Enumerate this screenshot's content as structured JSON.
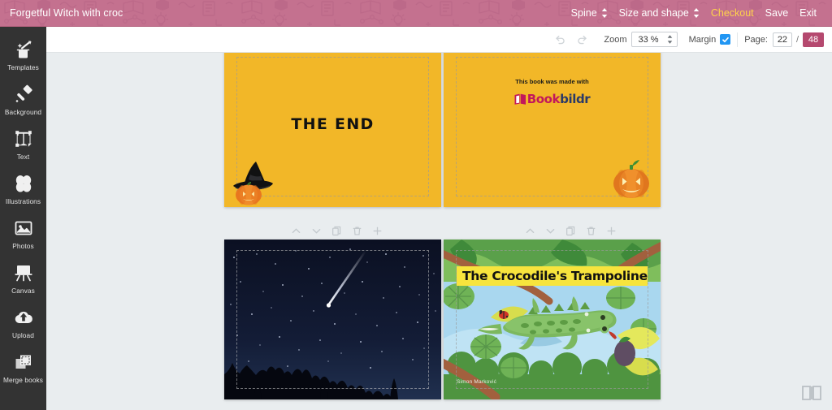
{
  "header": {
    "title": "Forgetful Witch with croc",
    "menu": [
      {
        "label": "Spine",
        "icon": "updown-arrows-icon",
        "name": "spine"
      },
      {
        "label": "Size and shape",
        "icon": "updown-arrows-icon",
        "name": "size-and-shape"
      },
      {
        "label": "Checkout",
        "icon": "",
        "name": "checkout"
      },
      {
        "label": "Save",
        "icon": "",
        "name": "save"
      },
      {
        "label": "Exit",
        "icon": "",
        "name": "exit"
      }
    ],
    "accent_color": "#c4718f",
    "checkout_color": "#ffd24a"
  },
  "sidebar": {
    "items": [
      {
        "label": "Templates",
        "icon": "magic-wand-hat-icon"
      },
      {
        "label": "Background",
        "icon": "paint-brush-icon"
      },
      {
        "label": "Text",
        "icon": "text-box-icon"
      },
      {
        "label": "Illustrations",
        "icon": "clover-shapes-icon"
      },
      {
        "label": "Photos",
        "icon": "photo-icon"
      },
      {
        "label": "Canvas",
        "icon": "easel-icon"
      },
      {
        "label": "Upload",
        "icon": "upload-cloud-icon"
      },
      {
        "label": "Merge books",
        "icon": "merge-books-icon"
      }
    ]
  },
  "toolbar": {
    "undo_icon": "undo-icon",
    "redo_icon": "redo-icon",
    "zoom_label": "Zoom",
    "zoom_value": "33 %",
    "margin_label": "Margin",
    "margin_checked": true,
    "page_label": "Page:",
    "page_current": "22",
    "page_separator": "/",
    "page_total": "48",
    "page_total_color": "#b5496f"
  },
  "page_controls": {
    "buttons": [
      {
        "icon": "chevron-up-icon",
        "name": "move-page-up"
      },
      {
        "icon": "chevron-down-icon",
        "name": "move-page-down"
      },
      {
        "icon": "duplicate-icon",
        "name": "duplicate-page"
      },
      {
        "icon": "trash-icon",
        "name": "delete-page"
      },
      {
        "icon": "plus-icon",
        "name": "add-page"
      }
    ]
  },
  "spreads": [
    {
      "name": "spread-upper",
      "left_page": {
        "name": "page-the-end",
        "background_color": "#f2b728",
        "text": "THE END",
        "art": [
          "witch-hat-pumpkin-illustration"
        ]
      },
      "right_page": {
        "name": "page-credits",
        "background_color": "#f2b728",
        "caption": "This book was made with",
        "logo_text_primary": "Book",
        "logo_text_secondary": "bildr",
        "logo_primary_color": "#c2185b",
        "logo_secondary_color": "#2b3a67",
        "art": [
          "jack-o-lantern-illustration"
        ]
      }
    },
    {
      "name": "spread-lower",
      "left_page": {
        "name": "page-night-sky",
        "background_color": "#0a1124",
        "art": [
          "starry-night-with-shooting-star-and-treeline"
        ]
      },
      "right_page": {
        "name": "page-crocodile-cover",
        "background_color": "#8dc66b",
        "title": "The Crocodile's Trampoline",
        "title_band_color": "#f7e43d",
        "author": "Simon Marković",
        "art": [
          "crocodile-in-pond-illustration"
        ]
      }
    }
  ],
  "floating": {
    "book_button_icon": "open-book-icon"
  }
}
